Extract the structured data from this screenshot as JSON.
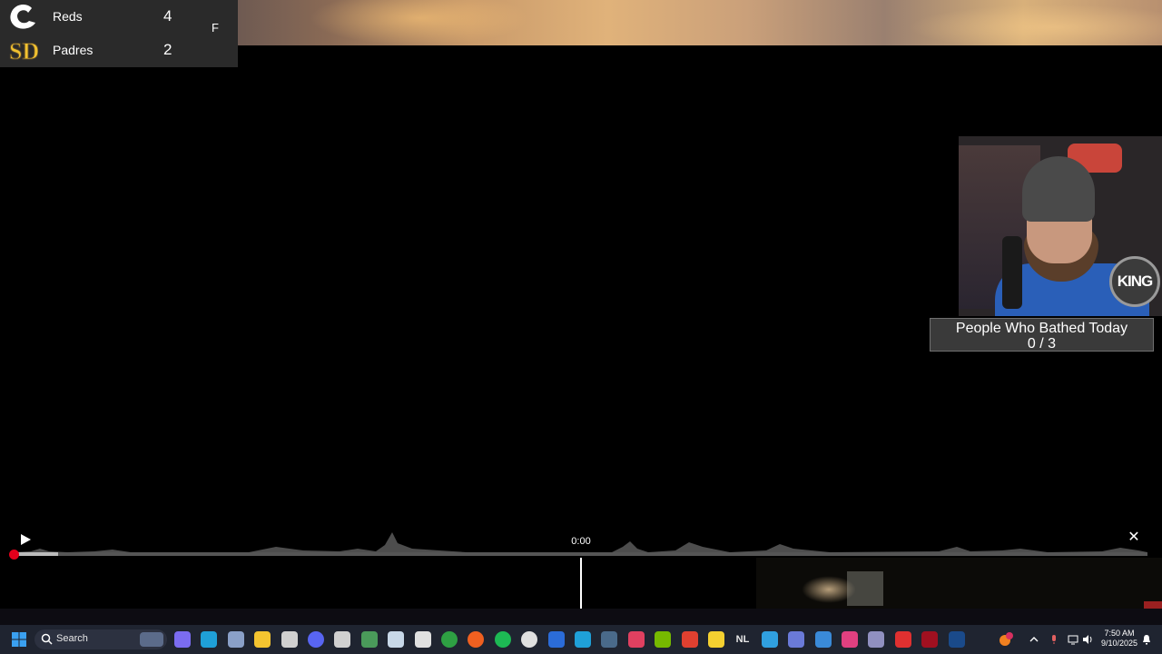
{
  "scoreboard": {
    "away": {
      "name": "Reds",
      "score": "4"
    },
    "home": {
      "name": "Padres",
      "score": "2"
    },
    "status": "F"
  },
  "counter": {
    "title": "People Who Bathed Today",
    "value": "0 / 3"
  },
  "webcam": {
    "badge": "KING"
  },
  "player": {
    "time": "0:00",
    "progress": 0.04,
    "play_icon": "play-icon",
    "close_icon": "close-icon"
  },
  "taskbar": {
    "search_label": "Search",
    "clock_time": "7:50 AM",
    "clock_date": "9/10/2025",
    "apps": [
      {
        "name": "copilot-icon",
        "color": "#7b6cf0"
      },
      {
        "name": "edge-icon",
        "color": "#1fa0d8"
      },
      {
        "name": "settings-icon",
        "color": "#8aa0c8"
      },
      {
        "name": "file-explorer-icon",
        "color": "#f4c430"
      },
      {
        "name": "obs-icon",
        "color": "#d0d0d0"
      },
      {
        "name": "discord-icon",
        "color": "#5865f2"
      },
      {
        "name": "streamlabs-icon",
        "color": "#d0d0d0"
      },
      {
        "name": "app-icon",
        "color": "#4a9a5a"
      },
      {
        "name": "steam-icon",
        "color": "#c8d8e8"
      },
      {
        "name": "epic-games-icon",
        "color": "#e0e0e0"
      },
      {
        "name": "xbox-icon",
        "color": "#2ea043"
      },
      {
        "name": "origin-icon",
        "color": "#f06020"
      },
      {
        "name": "spotify-icon",
        "color": "#1db954"
      },
      {
        "name": "app-circle-icon",
        "color": "#e0e0e0"
      },
      {
        "name": "word-icon",
        "color": "#2b6cd8"
      },
      {
        "name": "edge-dev-icon",
        "color": "#1fa0d8"
      },
      {
        "name": "calculator-icon",
        "color": "#4a6a8a"
      },
      {
        "name": "photo-app-icon",
        "color": "#e04060"
      },
      {
        "name": "nvidia-icon",
        "color": "#76b900"
      },
      {
        "name": "game-app-icon",
        "color": "#e04030"
      },
      {
        "name": "sticky-notes-icon",
        "color": "#f4d030"
      },
      {
        "name": "nl-icon",
        "color": "#e8e8e8"
      },
      {
        "name": "app-blue-icon",
        "color": "#30a0e0"
      },
      {
        "name": "phone-link-icon",
        "color": "#6a7ad8"
      },
      {
        "name": "store-icon",
        "color": "#3a8ad8"
      },
      {
        "name": "stream-deck-icon",
        "color": "#e04080"
      },
      {
        "name": "app-grey-icon",
        "color": "#9090c0"
      },
      {
        "name": "app-red-icon",
        "color": "#e03030"
      },
      {
        "name": "app-dark-red-icon",
        "color": "#a01020"
      },
      {
        "name": "app-dark-icon",
        "color": "#1a4a8a"
      }
    ],
    "tray": [
      "notification-badge-icon",
      "chevron-up-icon",
      "microphone-icon",
      "network-icon",
      "volume-icon",
      "notification-icon"
    ]
  }
}
